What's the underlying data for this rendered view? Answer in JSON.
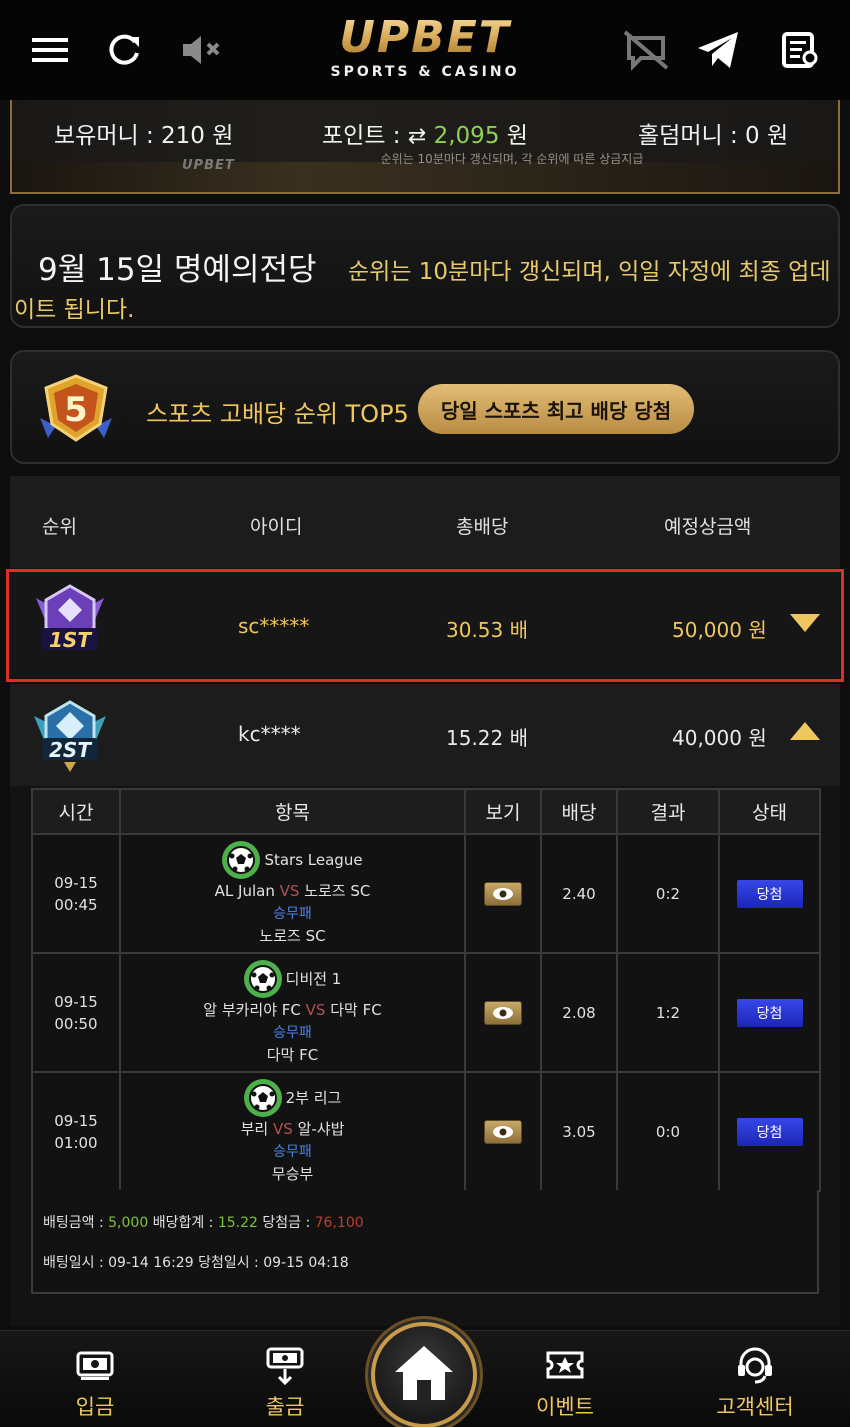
{
  "header": {
    "logo_main": "UPBET",
    "logo_sub": "SPORTS & CASINO"
  },
  "balance": {
    "money_label": "보유머니 : 210 원",
    "point_label": "포인트 :",
    "point_value": "2,095",
    "point_unit": "원",
    "holdem_label": "홀덤머니 : 0 원",
    "banner_ghost_text": "순위는 10분마다 갱신되며, 각 순위에 따른 상금지급",
    "banner_ghost_logo": "UPBET"
  },
  "fame": {
    "title": "9월 15일 명예의전당",
    "desc_line1": "순위는 10분마다 갱신되며, 익일 자정에 최종 업데",
    "desc_line2": "이트 됩니다."
  },
  "top5": {
    "badge_number": "5",
    "title": "스포츠 고배당 순위 TOP5",
    "pill": "당일 스포츠 최고 배당 당첨"
  },
  "ranking": {
    "headers": [
      "순위",
      "아이디",
      "총배당",
      "예정상금액"
    ],
    "rows": [
      {
        "medal": "1ST",
        "id": "sc*****",
        "odds": "30.53 배",
        "prize": "50,000 원",
        "expanded": false
      },
      {
        "medal": "2ST",
        "id": "kc****",
        "odds": "15.22 배",
        "prize": "40,000 원",
        "expanded": true
      }
    ]
  },
  "detail": {
    "headers": [
      "시간",
      "항목",
      "보기",
      "배당",
      "결과",
      "상태"
    ],
    "rows": [
      {
        "date": "09-15",
        "time": "00:45",
        "league": "Stars League",
        "home": "AL Julan",
        "vs": "VS",
        "away": "노로즈 SC",
        "pick_type": "승무패",
        "pick": "노로즈 SC",
        "odds": "2.40",
        "result": "0:2",
        "status": "당첨"
      },
      {
        "date": "09-15",
        "time": "00:50",
        "league": "디비전 1",
        "home": "알 부카리야 FC",
        "vs": "VS",
        "away": "다막 FC",
        "pick_type": "승무패",
        "pick": "다막 FC",
        "odds": "2.08",
        "result": "1:2",
        "status": "당첨"
      },
      {
        "date": "09-15",
        "time": "01:00",
        "league": "2부 리그",
        "home": "부리",
        "vs": "VS",
        "away": "알-샤밥",
        "pick_type": "승무패",
        "pick": "무승부",
        "odds": "3.05",
        "result": "0:0",
        "status": "당첨"
      }
    ],
    "summary": {
      "bet_label": "배팅금액 :",
      "bet_value": "5,000",
      "odds_label": "배당합계 :",
      "odds_value": "15.22",
      "win_label": "당첨금 :",
      "win_value": "76,100",
      "dates": "배팅일시 : 09-14 16:29 당첨일시 : 09-15 04:18"
    }
  },
  "nav": {
    "items": [
      "입금",
      "출금",
      "이벤트",
      "고객센터"
    ],
    "home_icon": "home-icon"
  },
  "colors": {
    "gold": "#f0c65e",
    "green": "#8fd150",
    "status_blue": "#2a38d8",
    "highlight_red": "#d8312b"
  }
}
